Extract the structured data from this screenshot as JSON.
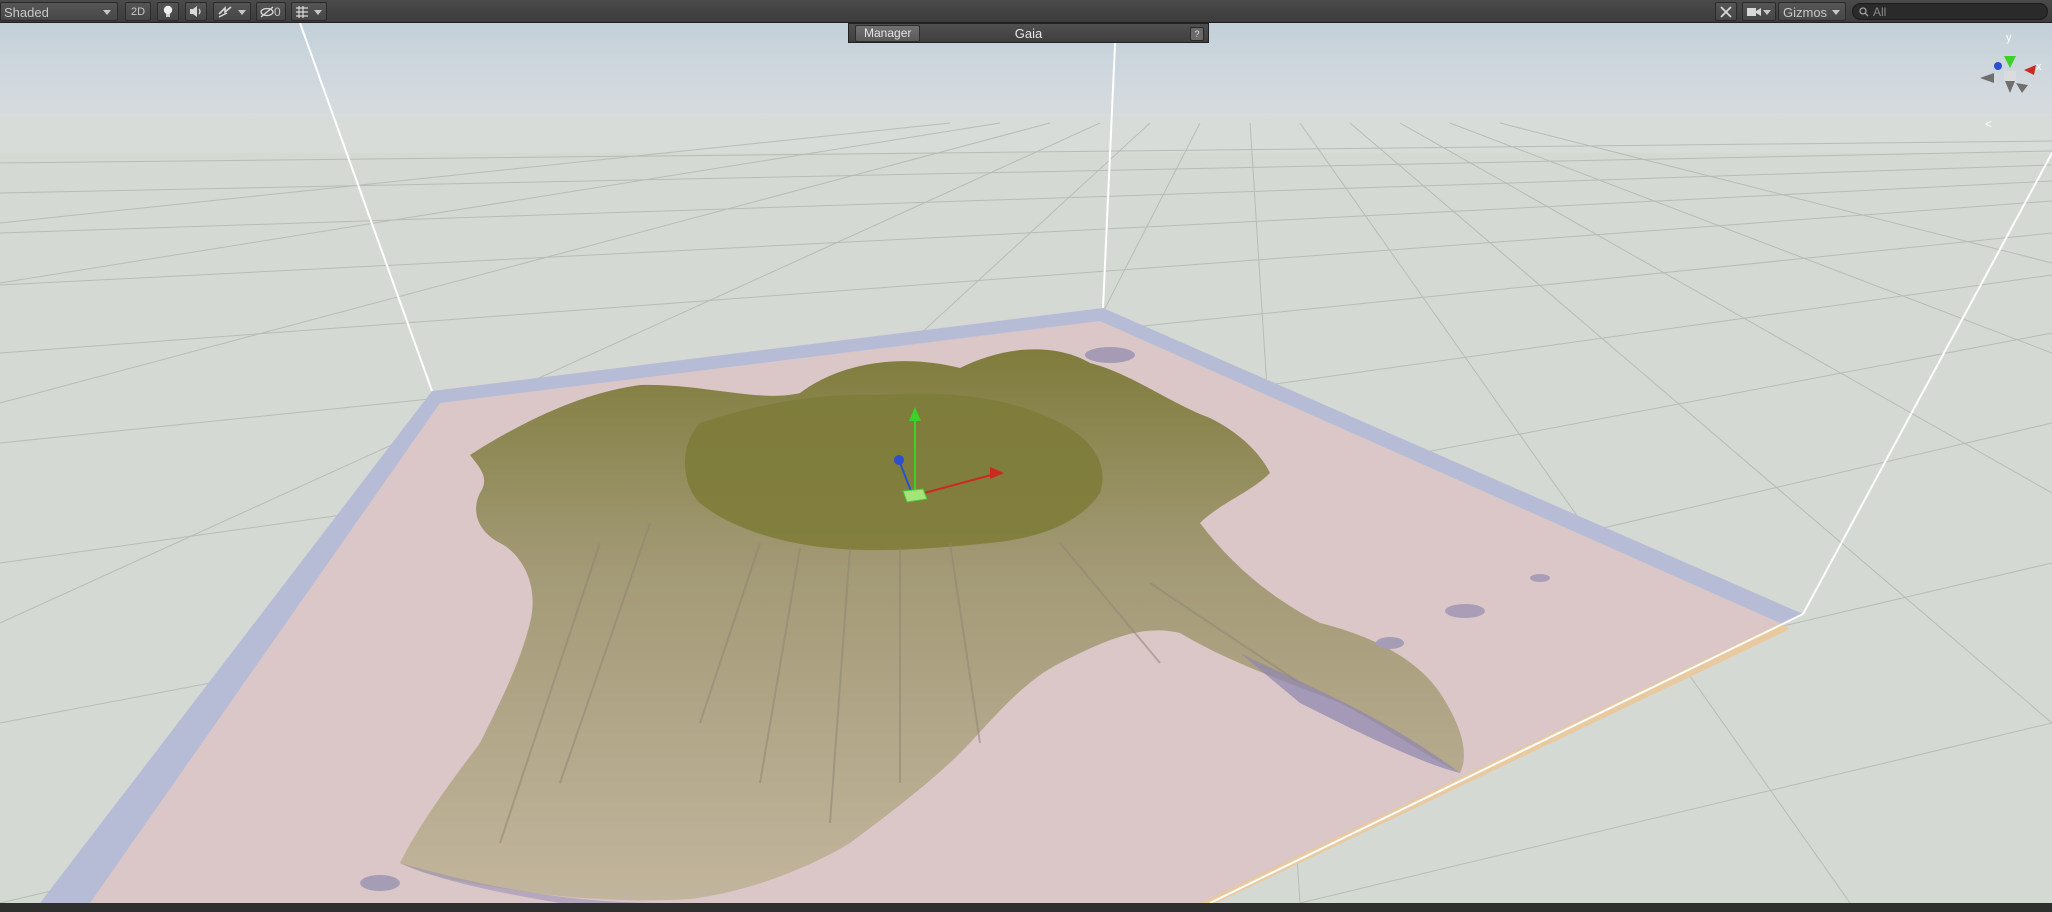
{
  "toolbar": {
    "draw_mode": "Shaded",
    "two_d_label": "2D",
    "hidden_count": "0",
    "gizmos_label": "Gizmos",
    "search_placeholder": "All",
    "icons": {
      "lighting": "lightbulb-icon",
      "audio": "speaker-icon",
      "effects": "effects-icon",
      "hidden": "eye-slash-icon",
      "grid": "grid-icon",
      "tools": "tools-icon",
      "camera": "camera-icon",
      "search": "search-icon"
    }
  },
  "gaia_panel": {
    "tab_label": "Manager",
    "title": "Gaia",
    "help_label": "?"
  },
  "scene": {
    "orientation_gizmo_axes": [
      "y",
      "x"
    ],
    "projection_label": "<",
    "colors": {
      "sky_top": "#c9d5dd",
      "ground": "#d7dad5",
      "grid_line": "#b9bdb8",
      "terrain_base": "#d9c4c7",
      "terrain_border": "#b8bfd6",
      "axis_x": "#cc2a1e",
      "axis_y": "#3bd12a",
      "axis_z": "#2b4fcf"
    }
  }
}
